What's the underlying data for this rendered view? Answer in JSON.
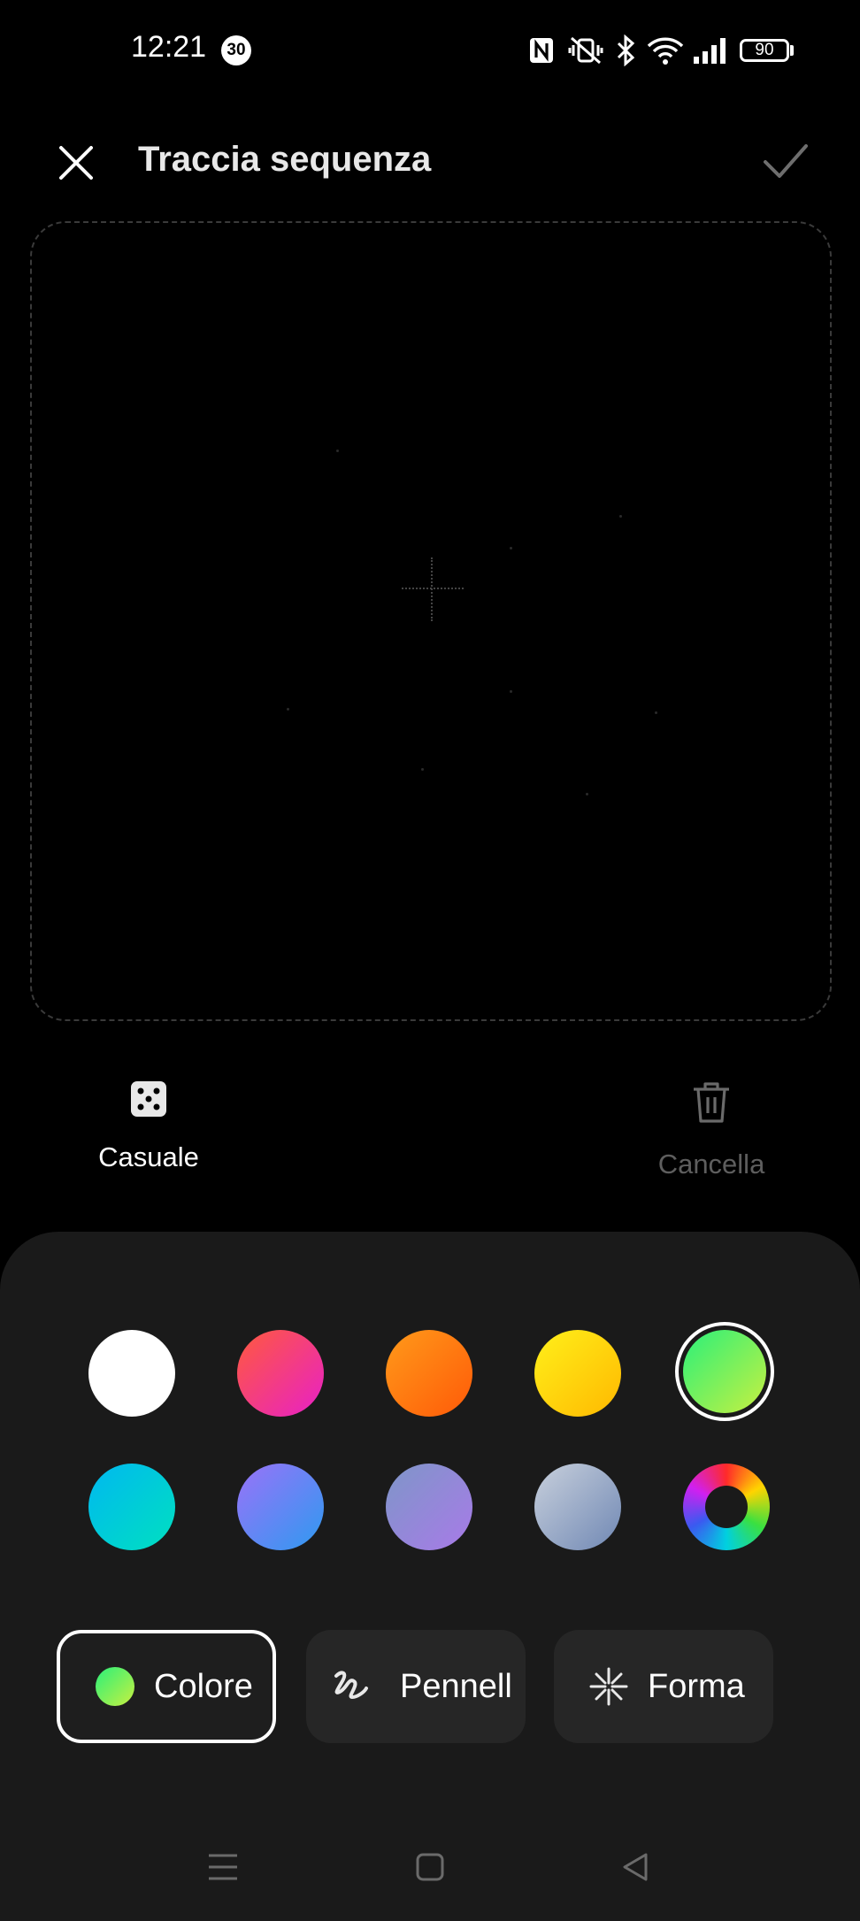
{
  "status_bar": {
    "time": "12:21",
    "notification_count": "30",
    "battery": "90"
  },
  "header": {
    "title": "Traccia sequenza"
  },
  "actions": {
    "random_label": "Casuale",
    "clear_label": "Cancella"
  },
  "palette": {
    "selected_index": 4,
    "swatches": [
      {
        "name": "white",
        "color": "#ffffff"
      },
      {
        "name": "pink-red",
        "color": "#f0306e"
      },
      {
        "name": "orange",
        "color": "#ff7a10"
      },
      {
        "name": "yellow",
        "color": "#ffd400"
      },
      {
        "name": "green",
        "color": "#5cf07a"
      },
      {
        "name": "cyan",
        "color": "#00c8e0"
      },
      {
        "name": "blue-violet",
        "color": "#6a86f5"
      },
      {
        "name": "lavender",
        "color": "#9a84dc"
      },
      {
        "name": "blue-gray",
        "color": "#9aa6c0"
      },
      {
        "name": "custom-color-wheel",
        "color": "rainbow"
      }
    ]
  },
  "tabs": [
    {
      "label": "Colore",
      "icon": "color-dot-icon",
      "selected": true
    },
    {
      "label": "Pennell",
      "icon": "brush-icon",
      "selected": false
    },
    {
      "label": "Forma",
      "icon": "shape-icon",
      "selected": false
    }
  ],
  "nav_bar": {
    "icons": [
      "menu-icon",
      "home-icon",
      "back-icon"
    ]
  }
}
